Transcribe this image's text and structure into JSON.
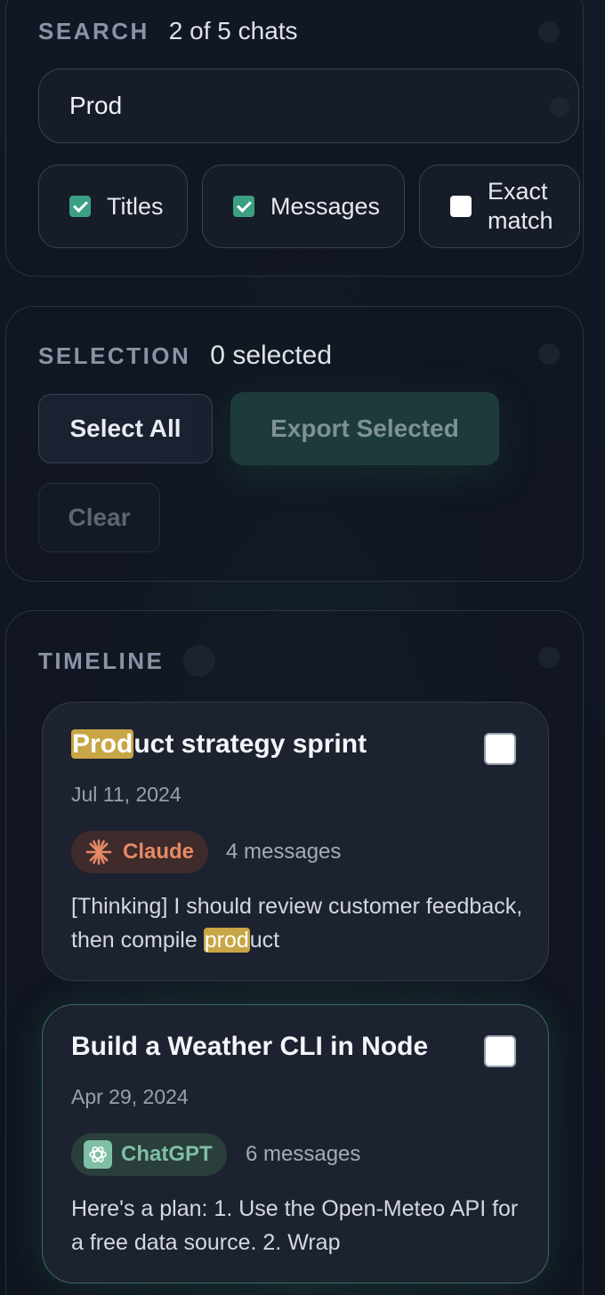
{
  "search": {
    "label": "SEARCH",
    "count": "2 of 5 chats",
    "query": "Prod",
    "filters": [
      {
        "label": "Titles",
        "checked": true
      },
      {
        "label": "Messages",
        "checked": true
      },
      {
        "label_line1": "Exact",
        "label_line2": "match",
        "checked": false
      }
    ]
  },
  "selection": {
    "label": "SELECTION",
    "count": "0 selected",
    "select_all": "Select All",
    "export": "Export Selected",
    "clear": "Clear"
  },
  "timeline": {
    "label": "TIMELINE",
    "cards": [
      {
        "title_match": "Prod",
        "title_rest": "uct strategy sprint",
        "date": "Jul 11, 2024",
        "source": "Claude",
        "source_icon": "claude-sunburst-icon",
        "messages": "4 messages",
        "preview_before": "[Thinking] I should review customer feedback, then compile ",
        "preview_match": "prod",
        "preview_after": "uct",
        "checked": false
      },
      {
        "title": "Build a Weather CLI in Node",
        "date": "Apr 29, 2024",
        "source": "ChatGPT",
        "source_icon": "chatgpt-logo-icon",
        "messages": "6 messages",
        "preview": "Here's a plan: 1. Use the Open-Meteo API for a free data source. 2. Wrap",
        "checked": false
      }
    ]
  },
  "colors": {
    "background": "#0f1521",
    "highlight": "#c8a545",
    "accent": "#3c9f84",
    "claude": "#e58a63",
    "chatgpt": "#7fbfa6"
  }
}
